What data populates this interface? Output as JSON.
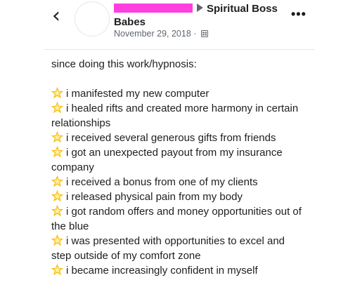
{
  "header": {
    "back_icon": "chevron-left-icon",
    "group_name_part1": "Spiritual Boss",
    "group_name_part2": "Babes",
    "date": "November 29, 2018",
    "separator": "·",
    "privacy_icon": "group-privacy-icon",
    "more_icon": "more-options-icon"
  },
  "post": {
    "intro": "since doing this work/hypnosis:",
    "bullet_icon": "glowing-star-emoji",
    "items": [
      "i manifested my new computer",
      "i healed rifts and created more harmony in certain relationships",
      "i received several generous gifts from friends",
      "i got an unexpected payout from my insurance company",
      "i received a bonus from one of my clients",
      "i released physical pain from my body",
      "i got random offers and money opportunities out of the blue",
      "i was presented with opportunities to excel and step outside of my comfort zone",
      "i became increasingly confident in myself"
    ]
  },
  "colors": {
    "text": "#1c1e21",
    "meta_text": "#606770",
    "redaction": "#ff3fe0",
    "star_fill": "#ffd43b",
    "divider": "#e4e6eb"
  }
}
